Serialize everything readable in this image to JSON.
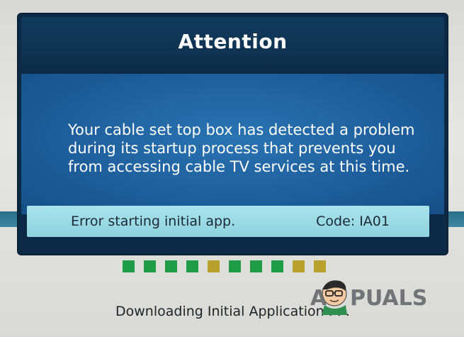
{
  "dialog": {
    "title": "Attention",
    "message_lines": [
      "Your cable set top box has detected a problem",
      "during its startup process that prevents you",
      "from accessing cable TV services at this time."
    ],
    "error_text": "Error starting initial app.",
    "error_code": "Code: IA01"
  },
  "progress": {
    "squares": [
      "green",
      "green",
      "green",
      "green",
      "olive",
      "green",
      "green",
      "green",
      "olive",
      "olive"
    ],
    "colors": {
      "green": "#1f9c45",
      "olive": "#b8a12c"
    }
  },
  "status_text": "Downloading Initial Application . . .",
  "watermark": {
    "text": "A PUALS"
  },
  "colors": {
    "dialog_header": "#0f3352",
    "dialog_body": "#1e5f9c",
    "error_bar": "#9edbe5"
  }
}
